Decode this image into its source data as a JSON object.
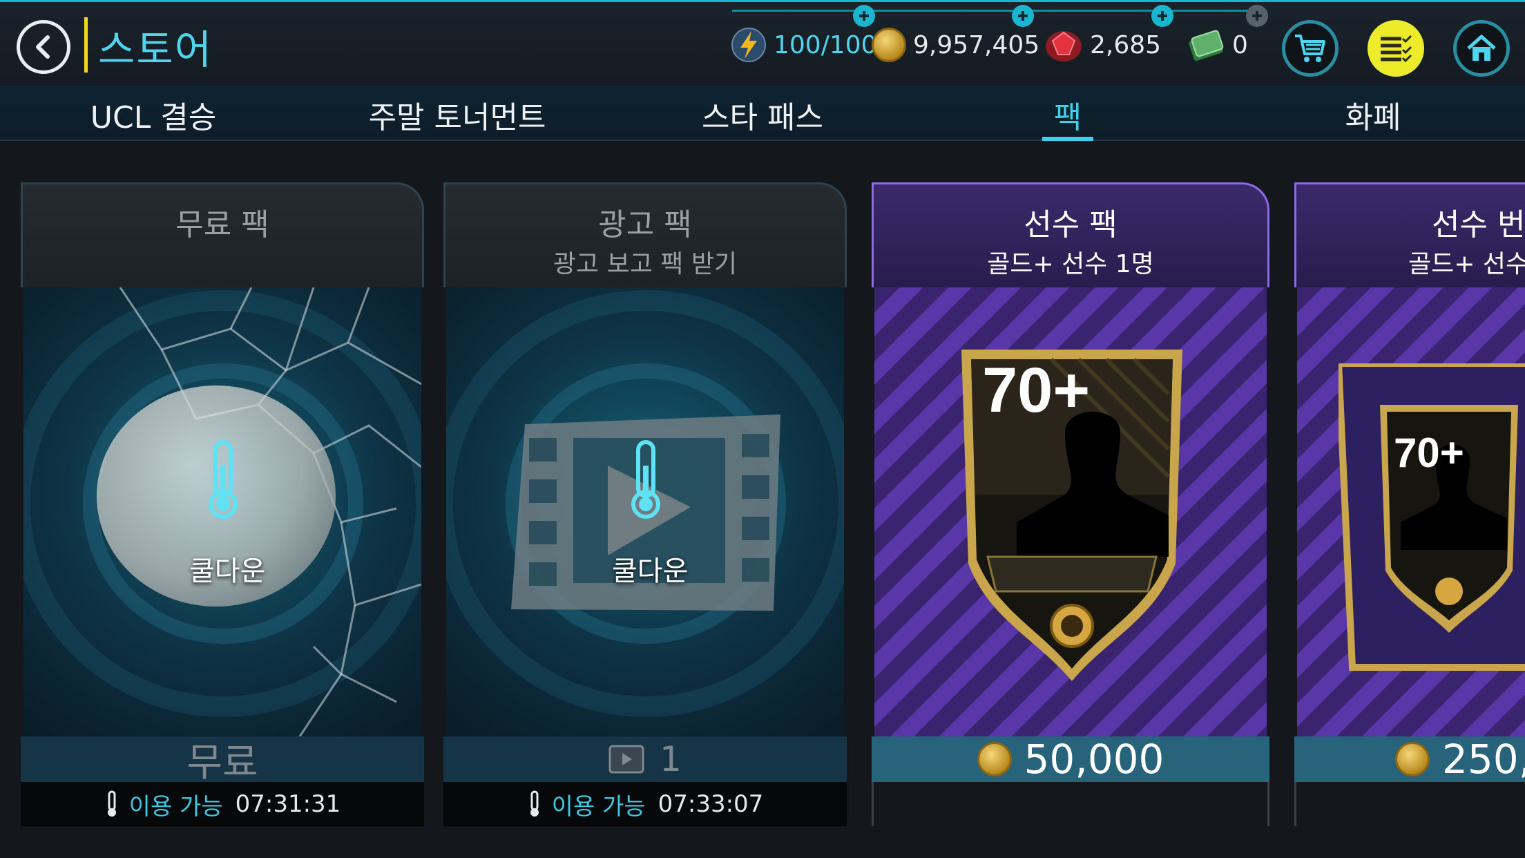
{
  "header": {
    "title": "스토어",
    "energy": {
      "current": "100",
      "separator": "/",
      "max": "100"
    },
    "coins": "9,957,405",
    "gems": "2,685",
    "tickets": "0",
    "colors": {
      "accent": "#3fd0ec",
      "title_bar": "#f0d821",
      "menu_button": "#ecec2a"
    }
  },
  "tabs": [
    {
      "label": "UCL 결승"
    },
    {
      "label": "주말 토너먼트"
    },
    {
      "label": "스타 패스"
    },
    {
      "label": "팩",
      "active": true
    },
    {
      "label": "화폐"
    }
  ],
  "cards": [
    {
      "title": "무료 팩",
      "subtitle": "",
      "overlay": "쿨다운",
      "price": "무료",
      "footer": {
        "status": "이용 가능",
        "time": "07:31:31"
      }
    },
    {
      "title": "광고 팩",
      "subtitle": "광고 보고 팩 받기",
      "overlay": "쿨다운",
      "price": "1",
      "footer": {
        "status": "이용 가능",
        "time": "07:33:07"
      }
    },
    {
      "title": "선수 팩",
      "subtitle": "골드+ 선수 1명",
      "rating": "70+",
      "price": "50,000"
    },
    {
      "title": "선수 번",
      "subtitle": "골드+ 선수",
      "rating": "70+",
      "price": "250,("
    }
  ]
}
